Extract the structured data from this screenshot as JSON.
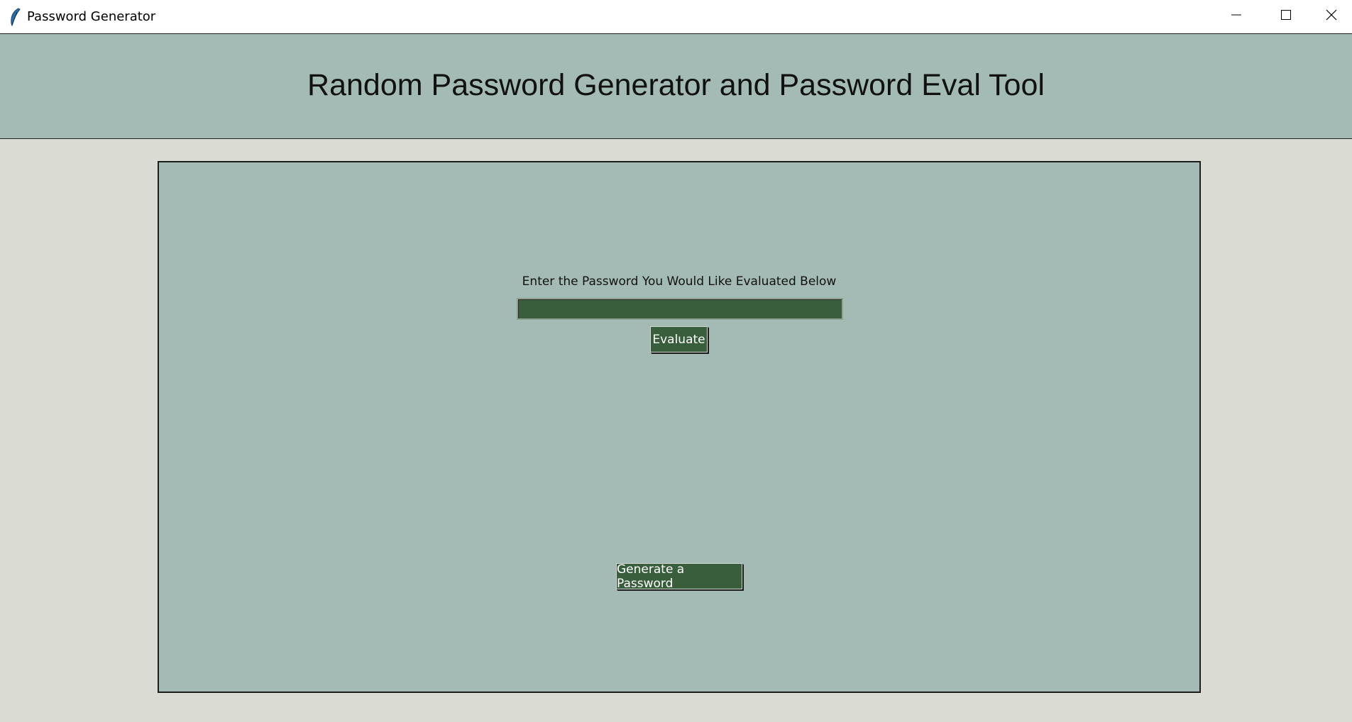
{
  "window": {
    "title": "Password Generator",
    "app_icon": "feather-icon",
    "controls": {
      "minimize_icon": "minimize-icon",
      "maximize_icon": "maximize-icon",
      "close_icon": "close-icon"
    }
  },
  "header": {
    "title": "Random Password Generator and Password Eval Tool"
  },
  "evaluate_section": {
    "prompt": "Enter the Password You Would Like Evaluated Below",
    "input_value": "",
    "input_placeholder": "",
    "evaluate_label": "Evaluate"
  },
  "generate_section": {
    "generate_label": "Generate a Password"
  },
  "colors": {
    "panel_bg": "#a3bbb4",
    "window_bg": "#dadcd4",
    "button_bg": "#385e3c",
    "button_text": "#ffffff"
  }
}
